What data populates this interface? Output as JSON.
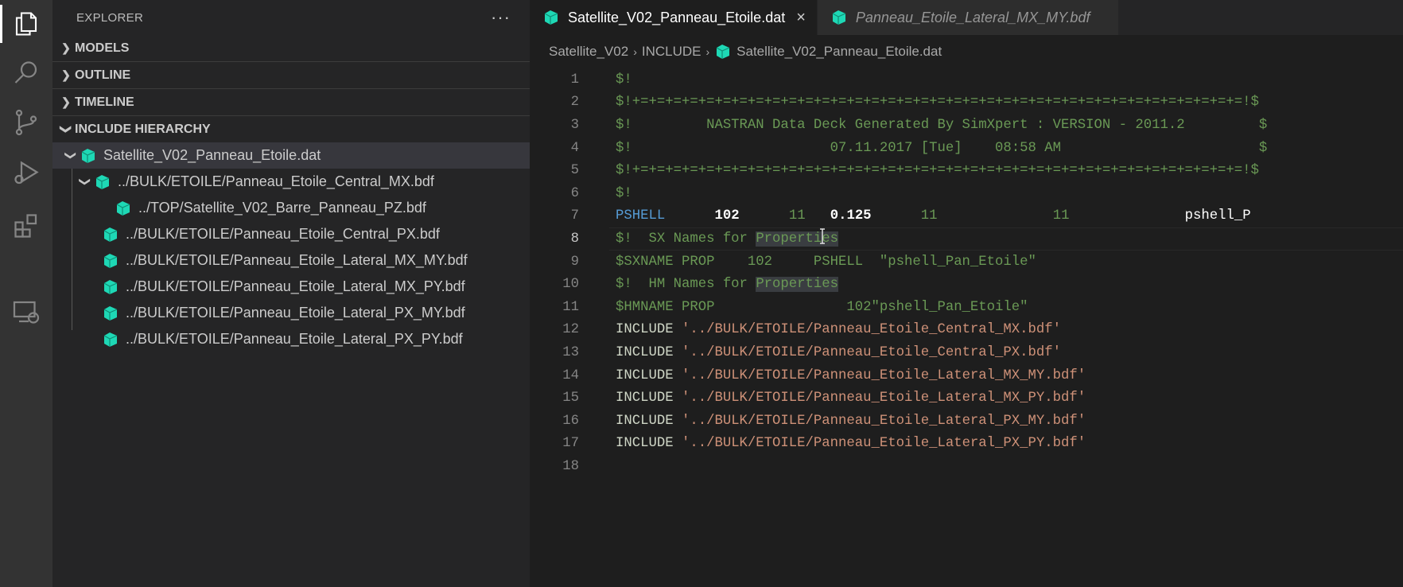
{
  "sidebar": {
    "title": "EXPLORER",
    "more_label": "···",
    "sections": {
      "models": "MODELS",
      "outline": "OUTLINE",
      "timeline": "TIMELINE",
      "include_hierarchy": "INCLUDE HIERARCHY"
    },
    "tree": {
      "root": "Satellite_V02_Panneau_Etoile.dat",
      "child1": "../BULK/ETOILE/Panneau_Etoile_Central_MX.bdf",
      "grandchild1": "../TOP/Satellite_V02_Barre_Panneau_PZ.bdf",
      "child2": "../BULK/ETOILE/Panneau_Etoile_Central_PX.bdf",
      "child3": "../BULK/ETOILE/Panneau_Etoile_Lateral_MX_MY.bdf",
      "child4": "../BULK/ETOILE/Panneau_Etoile_Lateral_MX_PY.bdf",
      "child5": "../BULK/ETOILE/Panneau_Etoile_Lateral_PX_MY.bdf",
      "child6": "../BULK/ETOILE/Panneau_Etoile_Lateral_PX_PY.bdf"
    }
  },
  "tabs": {
    "active": "Satellite_V02_Panneau_Etoile.dat",
    "close": "×",
    "inactive": "Panneau_Etoile_Lateral_MX_MY.bdf"
  },
  "breadcrumbs": {
    "part1": "Satellite_V02",
    "part2": "INCLUDE",
    "part3": "Satellite_V02_Panneau_Etoile.dat",
    "sep": "›"
  },
  "code": {
    "line_numbers": [
      "1",
      "2",
      "3",
      "4",
      "5",
      "6",
      "7",
      "8",
      "9",
      "10",
      "11",
      "12",
      "13",
      "14",
      "15",
      "16",
      "17",
      "18"
    ],
    "l1": "$!",
    "l2": "$!+=+=+=+=+=+=+=+=+=+=+=+=+=+=+=+=+=+=+=+=+=+=+=+=+=+=+=+=+=+=+=+=+=+=+=+=+=!$",
    "l3": "$!         NASTRAN Data Deck Generated By SimXpert : VERSION - 2011.2         $",
    "l4": "$!                        07.11.2017 [Tue]    08:58 AM                        $",
    "l5": "$!+=+=+=+=+=+=+=+=+=+=+=+=+=+=+=+=+=+=+=+=+=+=+=+=+=+=+=+=+=+=+=+=+=+=+=+=+=!$",
    "l6": "$!",
    "l7_kw": "PSHELL",
    "l7_a": "102",
    "l7_b": "11",
    "l7_c": "0.125",
    "l7_d": "11",
    "l7_e": "11",
    "l7_f": "pshell_P",
    "l8_a": "$!  SX Names for ",
    "l8_hl": "Properties",
    "l9": "$SXNAME PROP    102     PSHELL  \"pshell_Pan_Etoile\"",
    "l10_a": "$!  HM Names for ",
    "l10_hl": "Properties",
    "l11": "$HMNAME PROP                102\"pshell_Pan_Etoile\"",
    "inc_kw": "INCLUDE",
    "l12": "'../BULK/ETOILE/Panneau_Etoile_Central_MX.bdf'",
    "l13": "'../BULK/ETOILE/Panneau_Etoile_Central_PX.bdf'",
    "l14": "'../BULK/ETOILE/Panneau_Etoile_Lateral_MX_MY.bdf'",
    "l15": "'../BULK/ETOILE/Panneau_Etoile_Lateral_MX_PY.bdf'",
    "l16": "'../BULK/ETOILE/Panneau_Etoile_Lateral_PX_MY.bdf'",
    "l17": "'../BULK/ETOILE/Panneau_Etoile_Lateral_PX_PY.bdf'"
  },
  "colors": {
    "accent_file_icon": "#1ed8b5",
    "comment": "#6a9955",
    "keyword": "#569cd6",
    "string": "#ce9178"
  }
}
